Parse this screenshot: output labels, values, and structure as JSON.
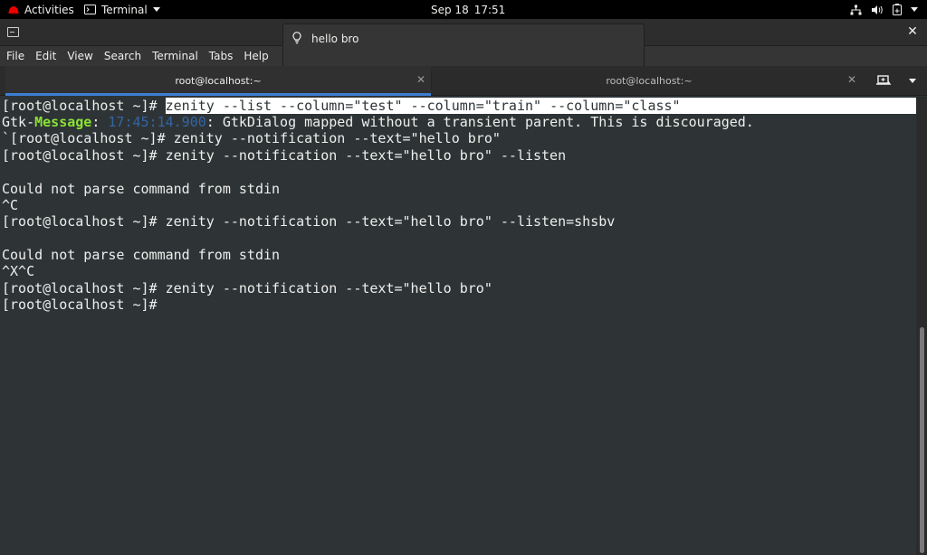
{
  "topbar": {
    "activities_label": "Activities",
    "app_label": "Terminal",
    "date": "Sep 18",
    "time": "17:51"
  },
  "notification": {
    "text": "hello bro",
    "icon": "lightbulb-icon"
  },
  "menu": {
    "items": [
      "File",
      "Edit",
      "View",
      "Search",
      "Terminal",
      "Tabs",
      "Help"
    ]
  },
  "tabs": [
    {
      "label": "root@localhost:~",
      "active": true
    },
    {
      "label": "root@localhost:~",
      "active": false
    }
  ],
  "terminal": {
    "prompt": "[root@localhost ~]# ",
    "selected_command": "zenity --list --column=\"test\" --column=\"train\" --column=\"class\"",
    "gtk_prefix": "Gtk-",
    "gtk_word": "Message",
    "gtk_colon": ": ",
    "gtk_time": "17:45:14.900",
    "gtk_rest": ": GtkDialog mapped without a transient parent. This is discouraged.",
    "lines": [
      "`[root@localhost ~]# zenity --notification --text=\"hello bro\"",
      "[root@localhost ~]# zenity --notification --text=\"hello bro\" --listen",
      "",
      "Could not parse command from stdin",
      "^C",
      "[root@localhost ~]# zenity --notification --text=\"hello bro\" --listen=shsbv",
      "",
      "Could not parse command from stdin",
      "^X^C",
      "[root@localhost ~]# zenity --notification --text=\"hello bro\"",
      "[root@localhost ~]#"
    ]
  },
  "colors": {
    "accent": "#3b7fd4",
    "terminal_bg": "#2e3436",
    "message_green": "#8ae234",
    "timestamp_blue": "#3465a4"
  }
}
